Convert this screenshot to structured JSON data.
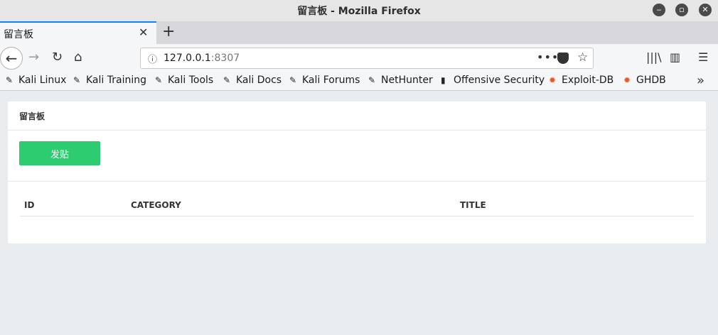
{
  "window": {
    "title": "留言板 - Mozilla Firefox"
  },
  "tab": {
    "title": "留言板",
    "close": "✕",
    "new": "+"
  },
  "navbar": {
    "url_host": "127.0.0.1",
    "url_port": ":8307",
    "more": "•••"
  },
  "bookmarks": {
    "items": [
      "Kali Linux",
      "Kali Training",
      "Kali Tools",
      "Kali Docs",
      "Kali Forums",
      "NetHunter",
      "Offensive Security",
      "Exploit-DB",
      "GHDB"
    ],
    "more": "»"
  },
  "page": {
    "title": "留言板",
    "post_button": "发贴",
    "table": {
      "columns": [
        "ID",
        "CATEGORY",
        "TITLE"
      ],
      "rows": []
    }
  }
}
